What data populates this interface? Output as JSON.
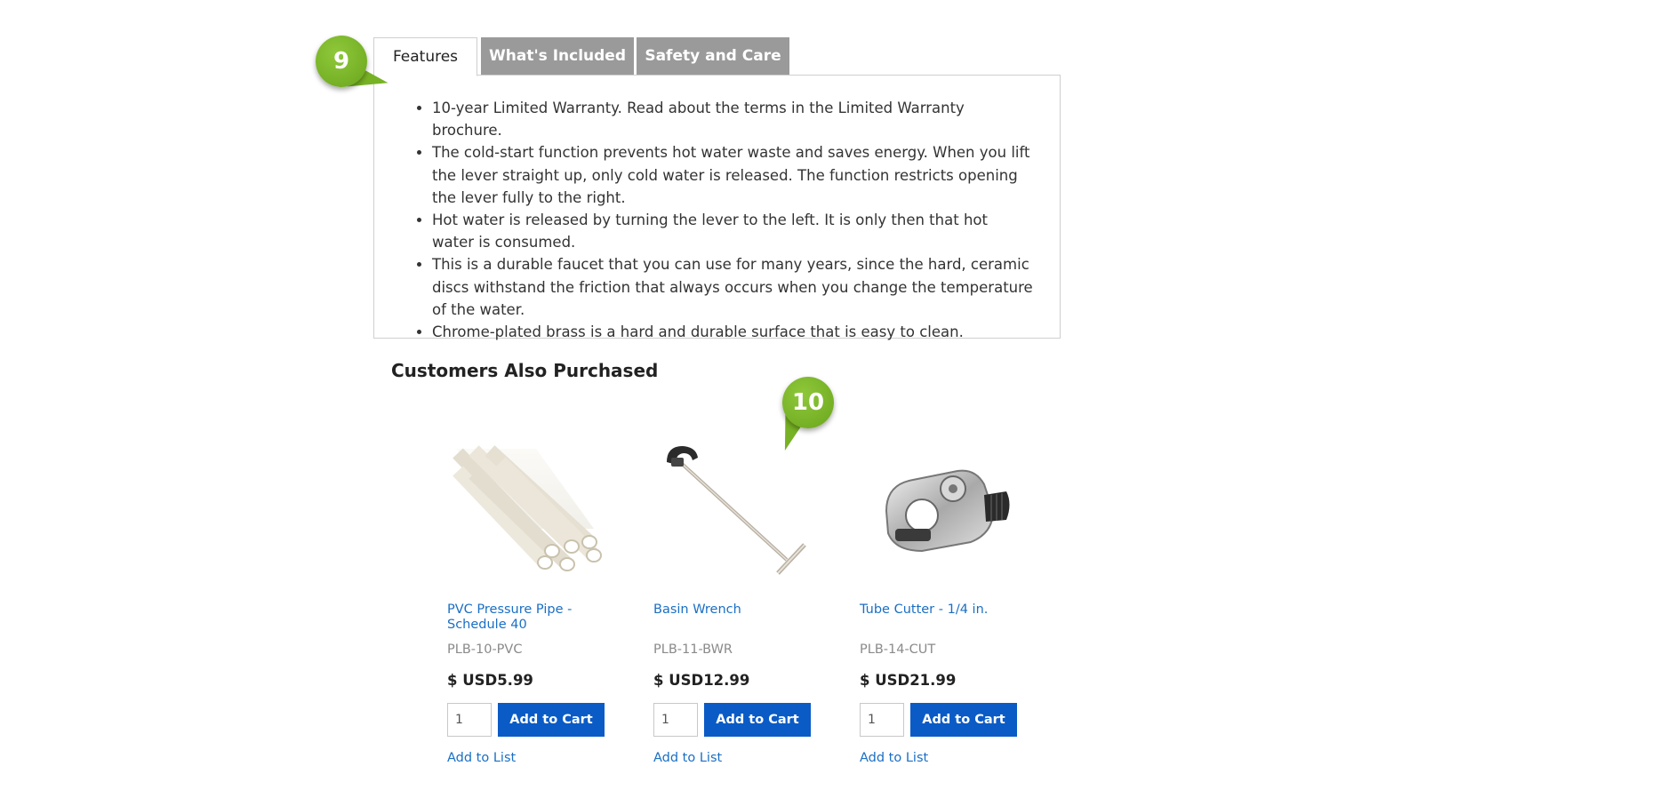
{
  "tabs": [
    {
      "label": "Features",
      "active": true
    },
    {
      "label": "What's Included",
      "active": false
    },
    {
      "label": "Safety and Care",
      "active": false
    }
  ],
  "features": [
    "10-year Limited Warranty. Read about the terms in the Limited Warranty brochure.",
    "The cold-start function prevents hot water waste and saves energy. When you lift the lever straight up, only cold water is released. The function restricts opening the lever fully to the right.",
    "Hot water is released by turning the lever to the left. It is only then that hot water is consumed.",
    "This is a durable faucet that you can use for many years, since the hard, ceramic discs withstand the friction that always occurs when you change the temperature of the water.",
    "Chrome-plated brass is a hard and durable surface that is easy to clean."
  ],
  "markers": {
    "features_marker": "9",
    "products_marker": "10"
  },
  "section_title": "Customers Also Purchased",
  "products": [
    {
      "name": "PVC Pressure Pipe - Schedule 40",
      "sku": "PLB-10-PVC",
      "price": "$ USD5.99",
      "quantity": "1",
      "add_to_cart_label": "Add to Cart",
      "add_to_list_label": "Add to List",
      "image_icon": "pvc-pipes-icon"
    },
    {
      "name": "Basin Wrench",
      "sku": "PLB-11-BWR",
      "price": "$ USD12.99",
      "quantity": "1",
      "add_to_cart_label": "Add to Cart",
      "add_to_list_label": "Add to List",
      "image_icon": "basin-wrench-icon"
    },
    {
      "name": "Tube Cutter - 1/4 in.",
      "sku": "PLB-14-CUT",
      "price": "$ USD21.99",
      "quantity": "1",
      "add_to_cart_label": "Add to Cart",
      "add_to_list_label": "Add to List",
      "image_icon": "tube-cutter-icon"
    }
  ],
  "colors": {
    "link": "#1a6fc4",
    "button": "#0a5bc6",
    "tab_inactive": "#9a9a9a",
    "marker": "#77b224"
  }
}
